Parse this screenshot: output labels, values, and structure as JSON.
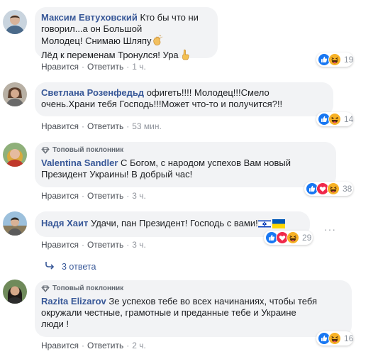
{
  "labels": {
    "like": "Нравится",
    "reply": "Ответить",
    "sep": "·",
    "top_fan": "Топовый поклонник"
  },
  "comments": [
    {
      "author": "Максим Евтуховский",
      "lines": [
        "Кто бы что ни говорил...а он Большой",
        "Молодец! Снимаю Шляпу",
        "Лёд к переменам Тронулся! Ура"
      ],
      "time": "1 ч.",
      "reactions": [
        "like",
        "haha"
      ],
      "count": "19"
    },
    {
      "author": "Светлана Розенфедьд",
      "lines": [
        "офигеть!!!! Молодец!!!Смело",
        "очень.Храни тебя Господь!!!Может что-то и получится?!!"
      ],
      "time": "53 мин.",
      "reactions": [
        "like",
        "haha"
      ],
      "count": "14"
    },
    {
      "author": "Valentina Sandler",
      "lines": [
        "С Богом, с народом успехов Вам новый",
        "Президент Украины! В добрый час!"
      ],
      "time": "3 ч.",
      "reactions": [
        "like",
        "love",
        "haha"
      ],
      "count": "38"
    },
    {
      "author": "Надя Хаит",
      "lines": [
        "Удачи, пан Президент! Господь с вами!"
      ],
      "time": "3 ч.",
      "reactions": [
        "like",
        "love",
        "haha"
      ],
      "count": "29"
    },
    {
      "author": "Razita Elizarov",
      "lines": [
        "Зе успехов тебе во всех начинаниях, чтобы тебя",
        "окружали честные, грамотные и преданные тебе и Украине",
        "люди !"
      ],
      "time": "2 ч.",
      "reactions": [
        "like",
        "haha"
      ],
      "count": "16"
    }
  ],
  "replies_link": "3 ответа",
  "colors": {
    "link": "#385898",
    "bubble": "#f2f3f5",
    "like": "#1877f2",
    "love": "#f0284a",
    "haha": "#f7b125"
  },
  "icons": [
    "clapping-hands-emoji",
    "pointing-up-emoji",
    "israel-flag-emoji",
    "ukraine-flag-emoji",
    "top-fan-diamond-icon",
    "reply-arrow-icon",
    "more-options-icon"
  ]
}
